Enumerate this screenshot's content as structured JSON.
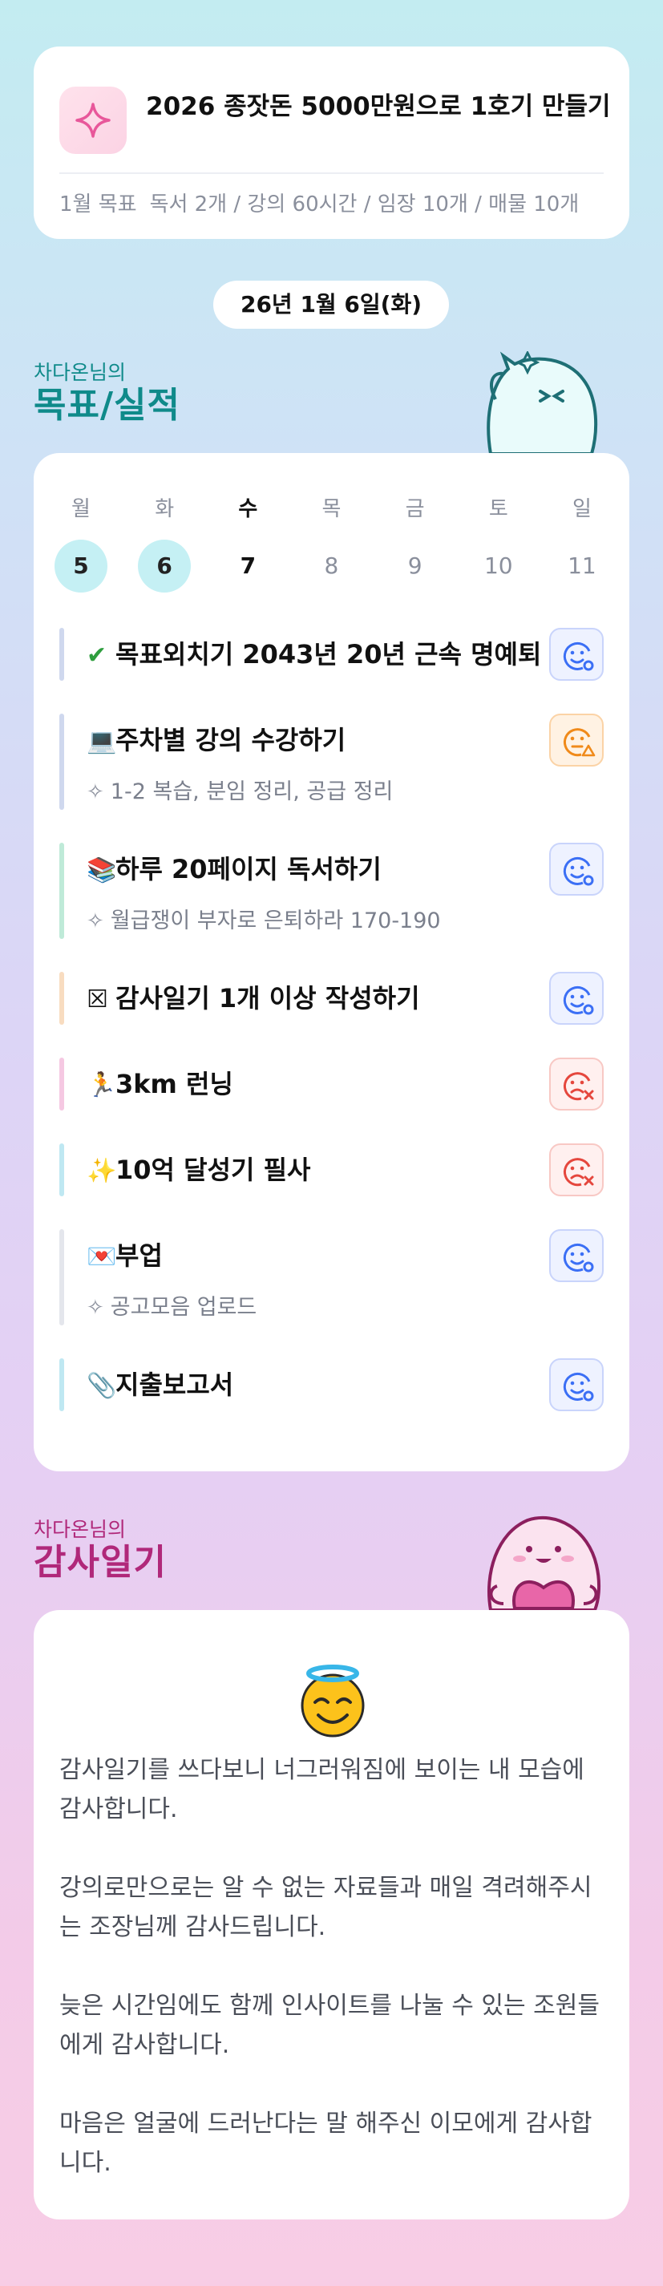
{
  "goal": {
    "title": "2026 종잣돈 5000만원으로 1호기 만들기",
    "month_label": "1월 목표",
    "month_goals": "독서 2개 / 강의 60시간 / 임장 10개 / 매물 10개"
  },
  "date_label": "26년 1월 6일(화)",
  "goals_section": {
    "owner": "차다온님의",
    "title": "목표/실적"
  },
  "week": [
    {
      "name": "월",
      "num": "5"
    },
    {
      "name": "화",
      "num": "6"
    },
    {
      "name": "수",
      "num": "7"
    },
    {
      "name": "목",
      "num": "8"
    },
    {
      "name": "금",
      "num": "9"
    },
    {
      "name": "토",
      "num": "10"
    },
    {
      "name": "일",
      "num": "11"
    }
  ],
  "tasks": [
    {
      "emoji": "✔",
      "title": "목표외치기 2043년 20년 근속 명예퇴",
      "sub": "",
      "status": "smile",
      "bar_color": "#cfd8ee"
    },
    {
      "emoji": "💻",
      "title": "주차별 강의 수강하기",
      "sub": "1-2 복습, 분임 정리, 공급 정리",
      "status": "warning",
      "bar_color": "#cfd8ee"
    },
    {
      "emoji": "📚",
      "title": "하루 20페이지 독서하기",
      "sub": "월급쟁이 부자로 은퇴하라 170-190",
      "status": "smile",
      "bar_color": "#bfead8"
    },
    {
      "emoji": "☒",
      "title": "감사일기 1개 이상 작성하기",
      "sub": "",
      "status": "smile",
      "bar_color": "#f8dcc0"
    },
    {
      "emoji": "🏃",
      "title": "3km 런닝",
      "sub": "",
      "status": "fail",
      "bar_color": "#f5c8e2"
    },
    {
      "emoji": "✨",
      "title": "10억 달성기 필사",
      "sub": "",
      "status": "fail",
      "bar_color": "#bfe8f2"
    },
    {
      "emoji": "💌",
      "title": "부업",
      "sub": "공고모음 업로드",
      "status": "smile",
      "bar_color": "#e4e6ec"
    },
    {
      "emoji": "📎",
      "title": "지출보고서",
      "sub": "",
      "status": "smile",
      "bar_color": "#bfe8f2"
    }
  ],
  "gratitude_section": {
    "owner": "차다온님의",
    "title": "감사일기"
  },
  "gratitude": {
    "emoji": "smiling-face-with-halo",
    "paragraphs": [
      "감사일기를 쓰다보니 너그러워짐에 보이는 내 모습에 감사합니다.",
      "강의로만으로는 알 수 없는 자료들과 매일 격려해주시는 조장님께 감사드립니다.",
      "늦은 시간임에도 함께 인사이트를 나눌 수 있는 조원들에게 감사합니다.",
      "마음은 얼굴에 드러난다는 말 해주신 이모에게 감사합니다."
    ]
  },
  "colors": {
    "accent_teal": "#0f8a8a",
    "accent_magenta": "#b0287a",
    "status_blue": "#3b6ff5",
    "status_orange": "#f08a1a",
    "status_red": "#e5473d"
  }
}
